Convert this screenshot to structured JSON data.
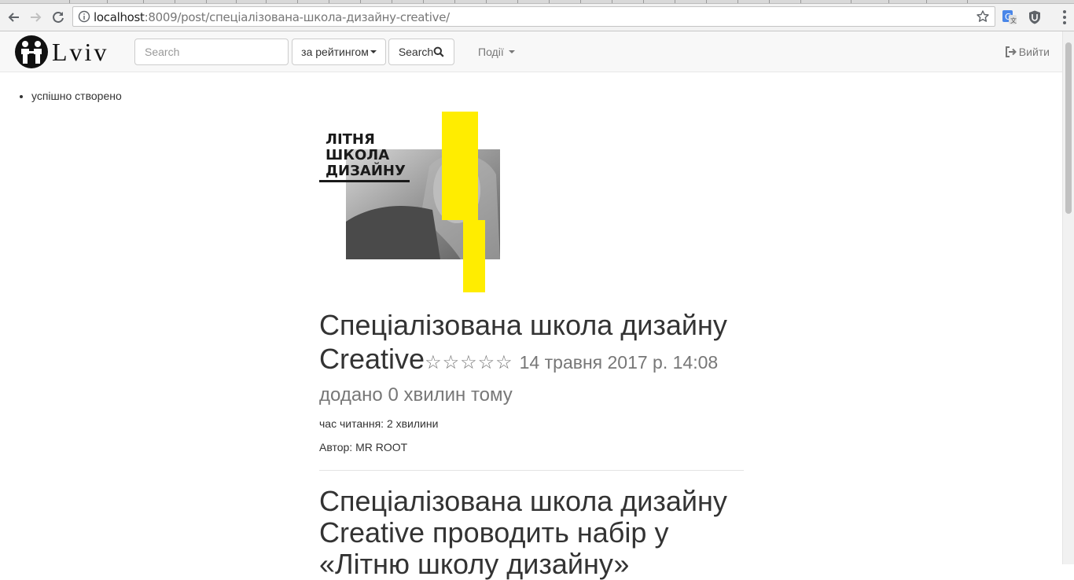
{
  "browser": {
    "url_host": "localhost",
    "url_rest": ":8009/post/спеціалізована-школа-дизайну-creative/"
  },
  "navbar": {
    "brand": "Lviv",
    "search_placeholder": "Search",
    "sort_label": "за рейтингом",
    "search_button": "Search",
    "events_label": "Події",
    "logout_label": "Вийти"
  },
  "flash": {
    "message": "успішно створено"
  },
  "poster": {
    "line1": "ЛІТНЯ",
    "line2": "ШКОЛА",
    "line3": "ДИЗАЙНУ",
    "accent_color": "#ffed00"
  },
  "post": {
    "title": "Спеціалізована школа дизайну Creative",
    "rating_stars": "☆☆☆☆☆",
    "date": "14 травня 2017 р. 14:08",
    "added": "додано 0 хвилин тому",
    "reading_time": "час читання: 2 хвилини",
    "author": "Автор: MR ROOT",
    "headline": "Спеціалізована школа дизайну Creative проводить набір у «Літню школу дизайну»"
  },
  "icons": {
    "back": "back-arrow-icon",
    "forward": "forward-arrow-icon",
    "reload": "reload-icon",
    "info": "info-icon",
    "bookmark": "star-icon",
    "translate": "translate-icon",
    "extension": "shield-icon",
    "menu": "kebab-menu-icon",
    "search": "search-icon",
    "logout": "logout-icon",
    "logo": "family-logo-icon"
  }
}
